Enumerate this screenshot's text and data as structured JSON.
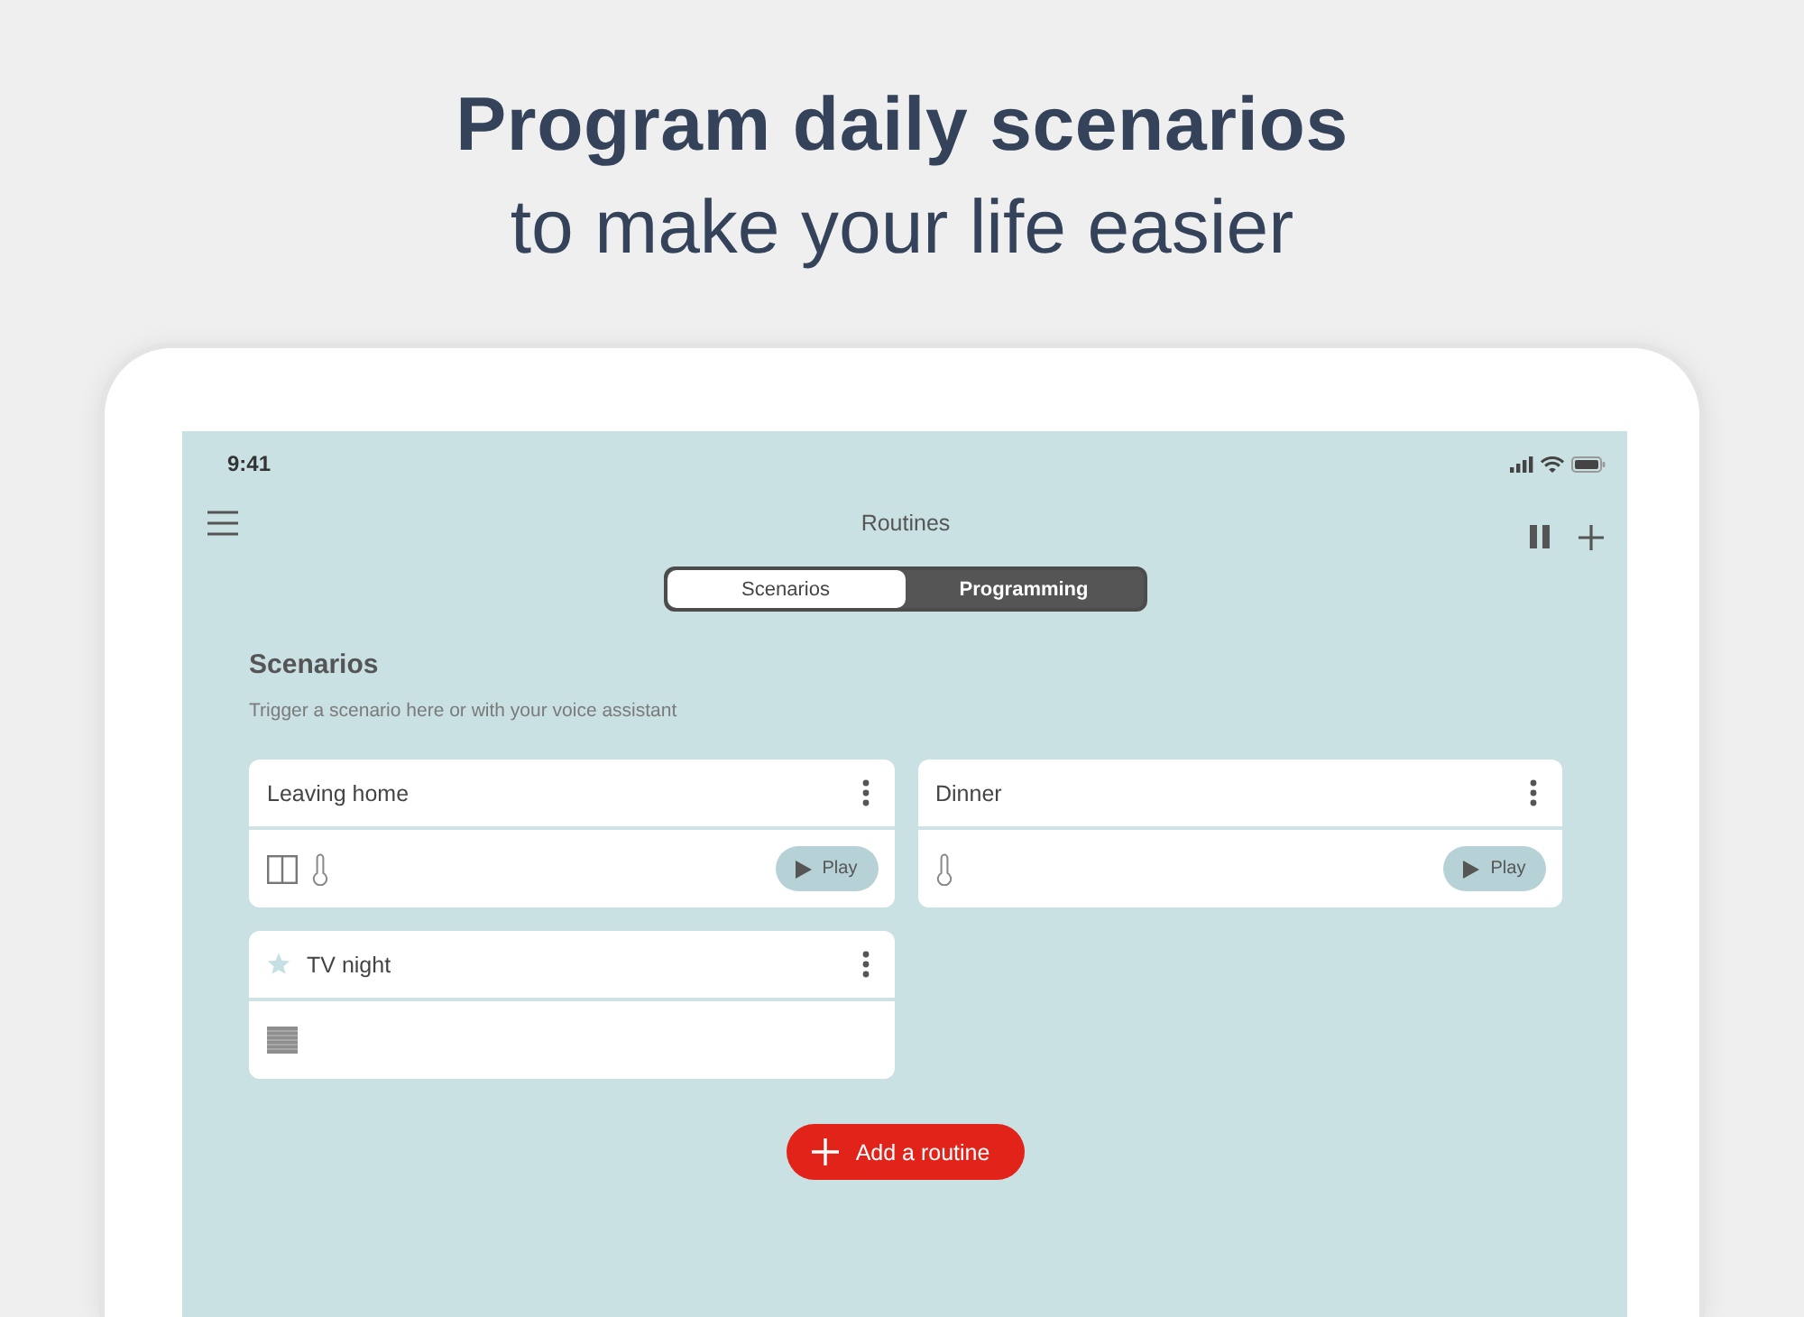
{
  "headline": {
    "title": "Program daily scenarios",
    "subtitle": "to make your life easier"
  },
  "status_bar": {
    "time": "9:41"
  },
  "nav": {
    "title": "Routines"
  },
  "tabs": [
    {
      "label": "Scenarios",
      "selected": true
    },
    {
      "label": "Programming",
      "selected": false
    }
  ],
  "section": {
    "title": "Scenarios",
    "description": "Trigger a scenario here or with your voice assistant"
  },
  "cards": [
    {
      "title": "Leaving home",
      "favorite": false,
      "devices": [
        {
          "kind": "window"
        },
        {
          "kind": "thermometer"
        }
      ],
      "play_label": "Play"
    },
    {
      "title": "Dinner",
      "favorite": false,
      "devices": [
        {
          "kind": "thermometer"
        }
      ],
      "play_label": "Play"
    },
    {
      "title": "TV night",
      "favorite": true,
      "devices": [
        {
          "kind": "blind"
        }
      ]
    }
  ],
  "add_button": {
    "label": "Add a routine"
  }
}
